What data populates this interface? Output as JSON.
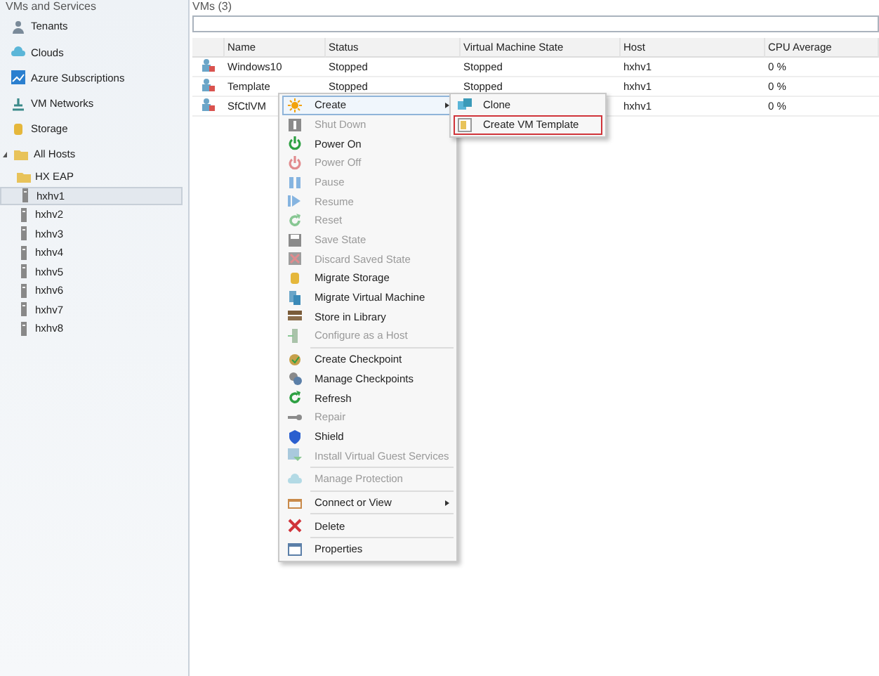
{
  "sidebar": {
    "title": "VMs and Services",
    "items": [
      {
        "label": "Tenants"
      },
      {
        "label": "Clouds"
      },
      {
        "label": "Azure Subscriptions"
      },
      {
        "label": "VM Networks"
      },
      {
        "label": "Storage"
      },
      {
        "label": "All Hosts",
        "expanded": true,
        "children": [
          {
            "kind": "folder",
            "label": "HX EAP",
            "selected": false
          },
          {
            "kind": "host",
            "label": "hxhv1",
            "selected": true
          },
          {
            "kind": "host",
            "label": "hxhv2",
            "selected": false
          },
          {
            "kind": "host",
            "label": "hxhv3",
            "selected": false
          },
          {
            "kind": "host",
            "label": "hxhv4",
            "selected": false
          },
          {
            "kind": "host",
            "label": "hxhv5",
            "selected": false
          },
          {
            "kind": "host",
            "label": "hxhv6",
            "selected": false
          },
          {
            "kind": "host",
            "label": "hxhv7",
            "selected": false
          },
          {
            "kind": "host",
            "label": "hxhv8",
            "selected": false
          }
        ]
      }
    ]
  },
  "main": {
    "title": "VMs (3)",
    "table": {
      "columns": [
        "Name",
        "Status",
        "Virtual Machine State",
        "Host",
        "CPU Average"
      ],
      "rows": [
        {
          "name": "Windows10",
          "status": "Stopped",
          "vm_state": "Stopped",
          "host": "hxhv1",
          "cpu": "0 %"
        },
        {
          "name": "Template",
          "status": "Stopped",
          "vm_state": "Stopped",
          "host": "hxhv1",
          "cpu": "0 %"
        },
        {
          "name": "SfCtlVM",
          "host": "hxhv1",
          "cpu": "0 %"
        }
      ]
    }
  },
  "context_menu": {
    "items": [
      {
        "kind": "item",
        "label": "Create",
        "disabled": false,
        "submenu": true,
        "selected": true
      },
      {
        "kind": "item",
        "label": "Shut Down",
        "disabled": true,
        "submenu": false,
        "selected": false
      },
      {
        "kind": "item",
        "label": "Power On",
        "disabled": false,
        "submenu": false,
        "selected": false
      },
      {
        "kind": "item",
        "label": "Power Off",
        "disabled": true,
        "submenu": false,
        "selected": false
      },
      {
        "kind": "item",
        "label": "Pause",
        "disabled": true,
        "submenu": false,
        "selected": false
      },
      {
        "kind": "item",
        "label": "Resume",
        "disabled": true,
        "submenu": false,
        "selected": false
      },
      {
        "kind": "item",
        "label": "Reset",
        "disabled": true,
        "submenu": false,
        "selected": false
      },
      {
        "kind": "item",
        "label": "Save State",
        "disabled": true,
        "submenu": false,
        "selected": false
      },
      {
        "kind": "item",
        "label": "Discard Saved State",
        "disabled": true,
        "submenu": false,
        "selected": false
      },
      {
        "kind": "item",
        "label": "Migrate Storage",
        "disabled": false,
        "submenu": false,
        "selected": false
      },
      {
        "kind": "item",
        "label": "Migrate Virtual Machine",
        "disabled": false,
        "submenu": false,
        "selected": false
      },
      {
        "kind": "item",
        "label": "Store in Library",
        "disabled": false,
        "submenu": false,
        "selected": false
      },
      {
        "kind": "item",
        "label": "Configure as a Host",
        "disabled": true,
        "submenu": false,
        "selected": false
      },
      {
        "kind": "separator"
      },
      {
        "kind": "item",
        "label": "Create Checkpoint",
        "disabled": false,
        "submenu": false,
        "selected": false
      },
      {
        "kind": "item",
        "label": "Manage Checkpoints",
        "disabled": false,
        "submenu": false,
        "selected": false
      },
      {
        "kind": "item",
        "label": "Refresh",
        "disabled": false,
        "submenu": false,
        "selected": false
      },
      {
        "kind": "item",
        "label": "Repair",
        "disabled": true,
        "submenu": false,
        "selected": false
      },
      {
        "kind": "item",
        "label": "Shield",
        "disabled": false,
        "submenu": false,
        "selected": false
      },
      {
        "kind": "item",
        "label": "Install Virtual Guest Services",
        "disabled": true,
        "submenu": false,
        "selected": false
      },
      {
        "kind": "separator"
      },
      {
        "kind": "item",
        "label": "Manage Protection",
        "disabled": true,
        "submenu": false,
        "selected": false
      },
      {
        "kind": "separator"
      },
      {
        "kind": "item",
        "label": "Connect or View",
        "disabled": false,
        "submenu": true,
        "selected": false
      },
      {
        "kind": "separator"
      },
      {
        "kind": "item",
        "label": "Delete",
        "disabled": false,
        "submenu": false,
        "selected": false
      },
      {
        "kind": "separator"
      },
      {
        "kind": "item",
        "label": "Properties",
        "disabled": false,
        "submenu": false,
        "selected": false
      }
    ]
  },
  "submenu": {
    "items": [
      {
        "label": "Clone",
        "highlighted": false
      },
      {
        "label": "Create VM Template",
        "highlighted": true
      }
    ]
  }
}
